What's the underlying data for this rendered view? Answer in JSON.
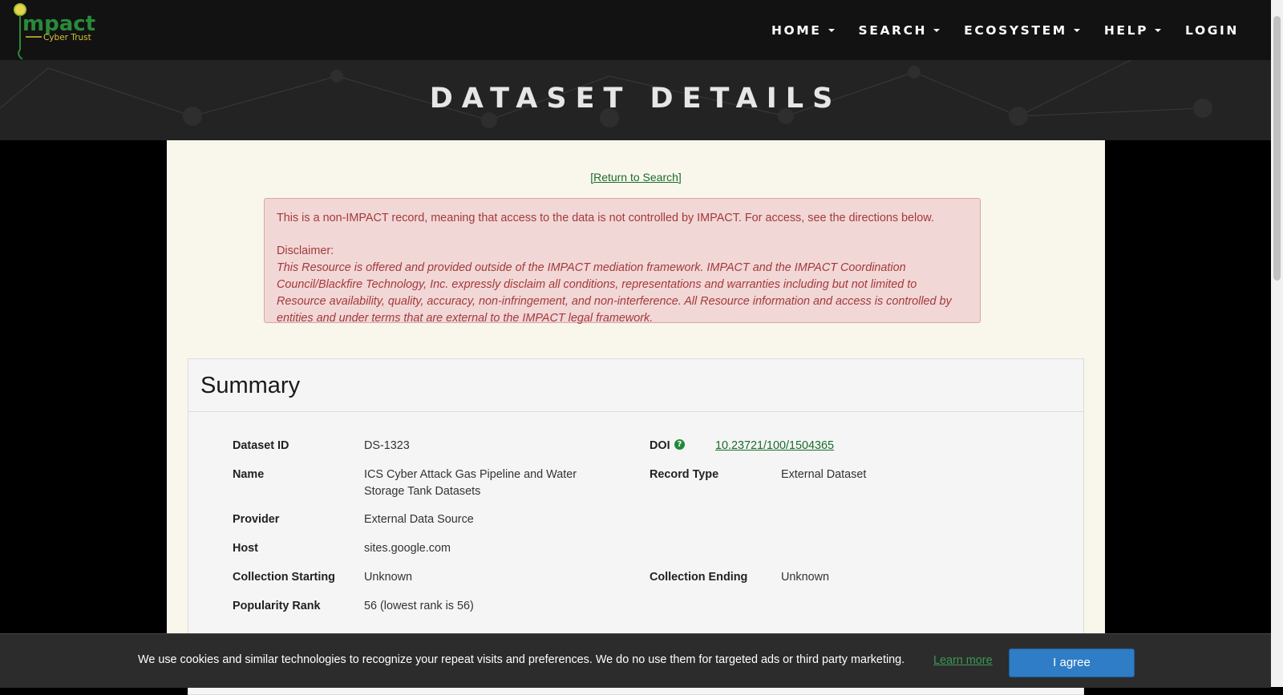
{
  "nav": {
    "logo_text": "Impact Cyber Trust",
    "items": [
      {
        "label": "HOME",
        "dropdown": true
      },
      {
        "label": "SEARCH",
        "dropdown": true
      },
      {
        "label": "ECOSYSTEM",
        "dropdown": true
      },
      {
        "label": "HELP",
        "dropdown": true
      },
      {
        "label": "LOGIN",
        "dropdown": false
      }
    ]
  },
  "hero": {
    "title": "DATASET DETAILS"
  },
  "return_link": "[Return to Search]",
  "alert": {
    "notice": "This is a non-IMPACT record, meaning that access to the data is not controlled by IMPACT. For access, see the directions below.",
    "disclaimer_label": "Disclaimer:",
    "disclaimer_text": "This Resource is offered and provided outside of the IMPACT mediation framework. IMPACT and the IMPACT Coordination Council/Blackfire Technology, Inc. expressly disclaim all conditions, representations and warranties including but not limited to Resource availability, quality, accuracy, non-infringement, and non-interference. All Resource information and access is controlled by entities and under terms that are external to the IMPACT legal framework."
  },
  "summary": {
    "title": "Summary",
    "dataset_id_label": "Dataset ID",
    "dataset_id": "DS-1323",
    "doi_label": "DOI",
    "doi": "10.23721/100/1504365",
    "name_label": "Name",
    "name": "ICS Cyber Attack Gas Pipeline and Water Storage Tank Datasets",
    "record_type_label": "Record Type",
    "record_type": "External Dataset",
    "provider_label": "Provider",
    "provider": "External Data Source",
    "host_label": "Host",
    "host": "sites.google.com",
    "collection_starting_label": "Collection Starting",
    "collection_starting": "Unknown",
    "collection_ending_label": "Collection Ending",
    "collection_ending": "Unknown",
    "popularity_label": "Popularity Rank",
    "popularity": "56 (lowest rank is 56)"
  },
  "cookie": {
    "text": "We use cookies and similar technologies to recognize your repeat visits and preferences. We do no use them for targeted ads or third party marketing.",
    "learn_more": "Learn more",
    "agree": "I agree"
  },
  "colors": {
    "nav_bg": "#121212",
    "link_green": "#1a6b2c",
    "alert_text": "#a33a3a",
    "agree_button": "#2e7dc6"
  }
}
